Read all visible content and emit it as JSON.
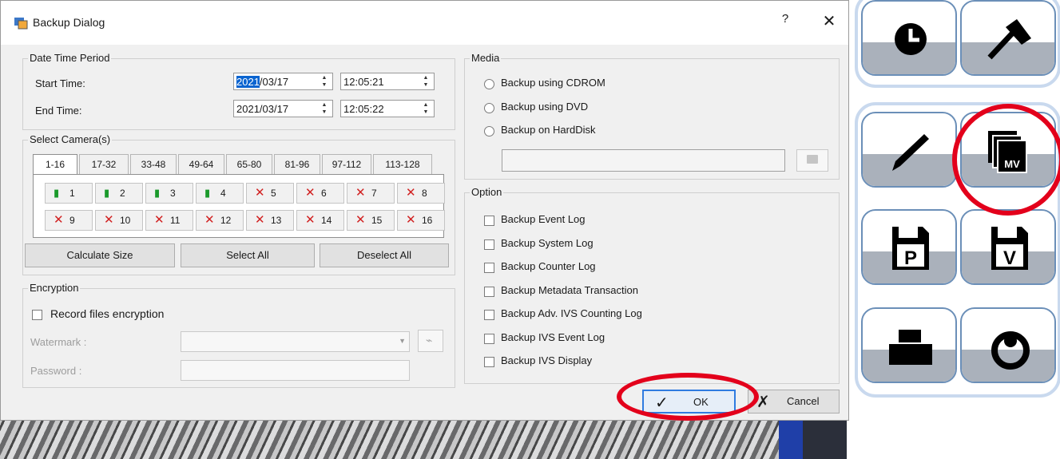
{
  "dialog": {
    "title": "Backup Dialog",
    "help_label": "?",
    "close_label": "✕"
  },
  "date_time": {
    "group_label": "Date Time Period",
    "start_label": "Start Time:",
    "start_date_selected": "2021",
    "start_date_rest": "/03/17",
    "start_time": "12:05:21",
    "end_label": "End Time:",
    "end_date": "2021/03/17",
    "end_time": "12:05:22"
  },
  "cameras": {
    "group_label": "Select Camera(s)",
    "tabs": [
      "1-16",
      "17-32",
      "33-48",
      "49-64",
      "65-80",
      "81-96",
      "97-112",
      "113-128"
    ],
    "active_tab": "1-16",
    "items": [
      {
        "num": "1",
        "status": "ok"
      },
      {
        "num": "2",
        "status": "ok"
      },
      {
        "num": "3",
        "status": "ok"
      },
      {
        "num": "4",
        "status": "ok"
      },
      {
        "num": "5",
        "status": "no"
      },
      {
        "num": "6",
        "status": "no"
      },
      {
        "num": "7",
        "status": "no"
      },
      {
        "num": "8",
        "status": "no"
      },
      {
        "num": "9",
        "status": "no"
      },
      {
        "num": "10",
        "status": "no"
      },
      {
        "num": "11",
        "status": "no"
      },
      {
        "num": "12",
        "status": "no"
      },
      {
        "num": "13",
        "status": "no"
      },
      {
        "num": "14",
        "status": "no"
      },
      {
        "num": "15",
        "status": "no"
      },
      {
        "num": "16",
        "status": "no"
      }
    ],
    "calculate_label": "Calculate Size",
    "select_all_label": "Select All",
    "deselect_all_label": "Deselect All"
  },
  "encryption": {
    "group_label": "Encryption",
    "record_label": "Record files encryption",
    "watermark_label": "Watermark :",
    "password_label": "Password :"
  },
  "media": {
    "group_label": "Media",
    "options": [
      "Backup using CDROM",
      "Backup using DVD",
      "Backup on HardDisk"
    ]
  },
  "option": {
    "group_label": "Option",
    "items": [
      "Backup Event Log",
      "Backup System Log",
      "Backup Counter Log",
      "Backup Metadata Transaction",
      "Backup Adv. IVS Counting Log",
      "Backup IVS Event Log",
      "Backup IVS Display"
    ]
  },
  "footer": {
    "ok_label": "OK",
    "cancel_label": "Cancel"
  },
  "toolbar": {
    "mv_label": "MV",
    "p_label": "P",
    "v_label": "V"
  },
  "colors": {
    "highlight": "#e3001b",
    "selection": "#0a64d0",
    "camera_ok": "#1b9a2b",
    "camera_off": "#d12020"
  }
}
